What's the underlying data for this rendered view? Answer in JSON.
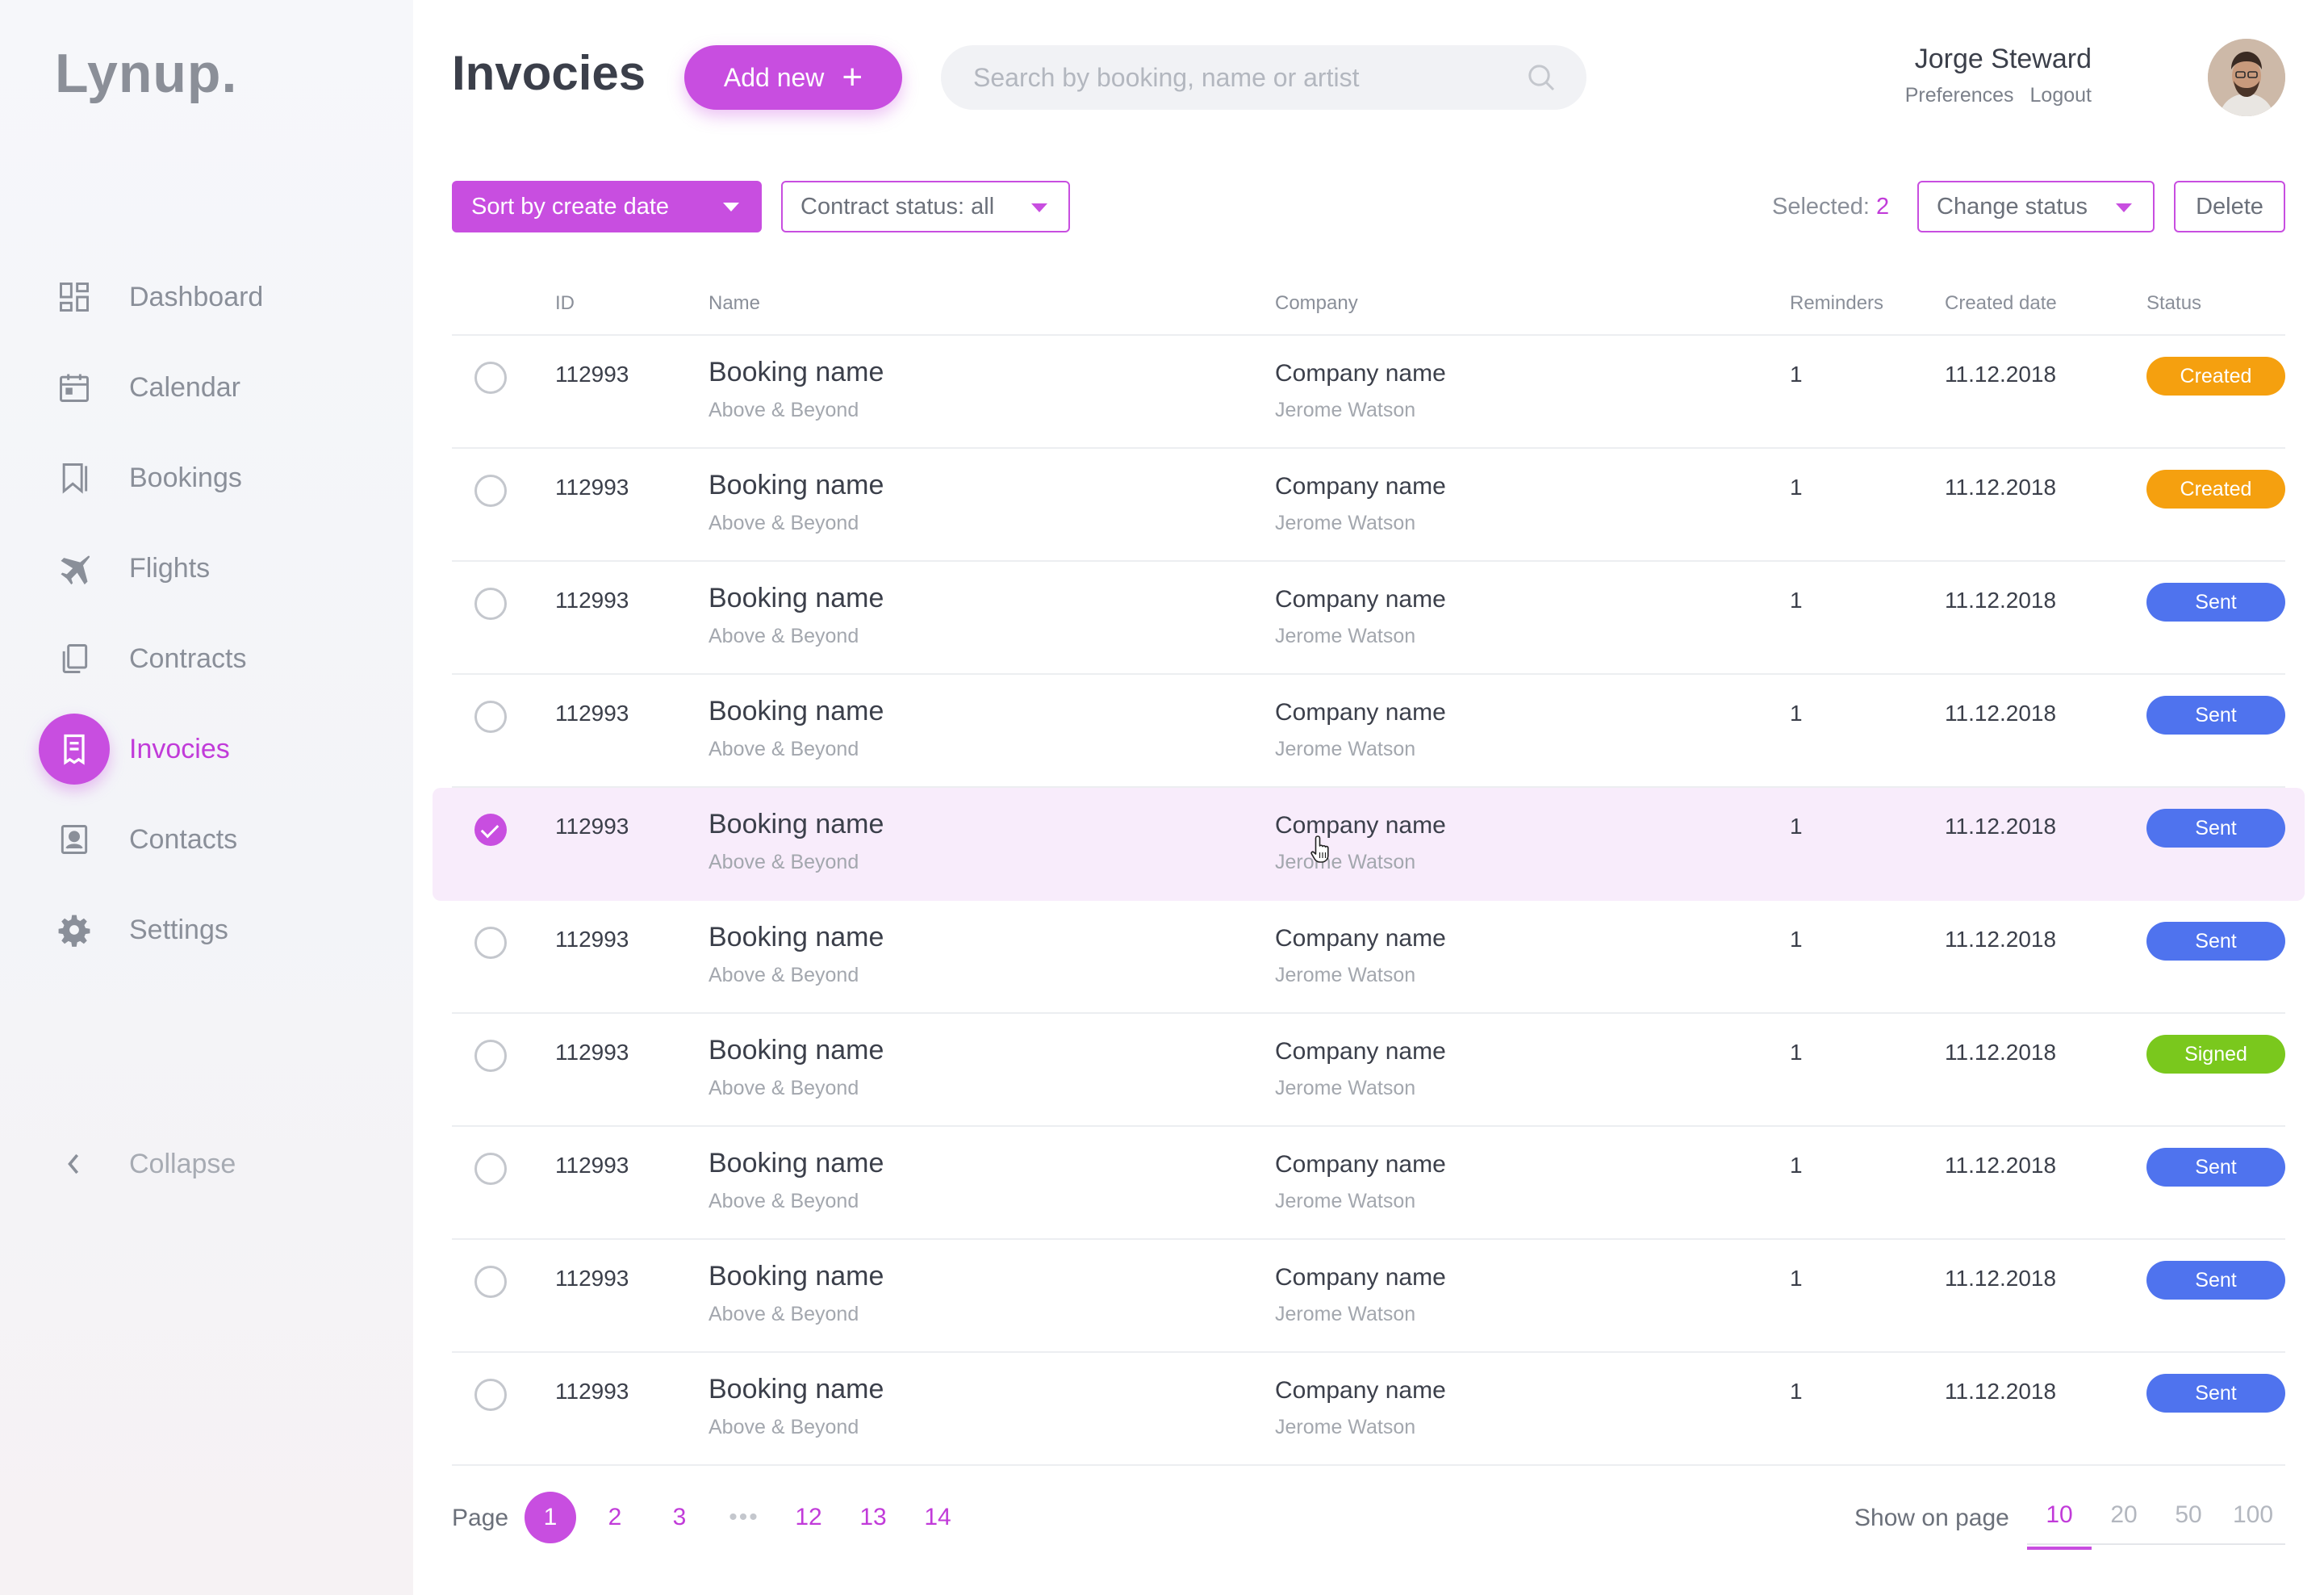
{
  "app": {
    "logo": "Lynup."
  },
  "sidebar": {
    "items": [
      {
        "label": "Dashboard",
        "icon": "grid-icon",
        "active": false
      },
      {
        "label": "Calendar",
        "icon": "calendar-icon",
        "active": false
      },
      {
        "label": "Bookings",
        "icon": "bookmark-icon",
        "active": false
      },
      {
        "label": "Flights",
        "icon": "airplane-icon",
        "active": false
      },
      {
        "label": "Contracts",
        "icon": "documents-icon",
        "active": false
      },
      {
        "label": "Invocies",
        "icon": "receipt-icon",
        "active": true
      },
      {
        "label": "Contacts",
        "icon": "contact-card-icon",
        "active": false
      },
      {
        "label": "Settings",
        "icon": "gear-icon",
        "active": false
      }
    ],
    "collapse_label": "Collapse"
  },
  "header": {
    "title": "Invocies",
    "add_new_label": "Add new",
    "search_placeholder": "Search by booking, name or artist",
    "user": {
      "name": "Jorge Steward",
      "preferences": "Preferences",
      "logout": "Logout"
    }
  },
  "toolbar": {
    "sort_label": "Sort by create date",
    "contract_filter_label": "Contract status: all",
    "selected_label": "Selected:",
    "selected_count": "2",
    "change_status_label": "Change status",
    "delete_label": "Delete"
  },
  "colors": {
    "accent": "#c84ee0",
    "created": "#f5a00f",
    "sent": "#4f73ee",
    "signed": "#7ac81d"
  },
  "table": {
    "columns": {
      "id": "ID",
      "name": "Name",
      "company": "Company",
      "reminders": "Reminders",
      "created": "Created date",
      "status": "Status"
    },
    "rows": [
      {
        "checked": false,
        "id": "112993",
        "name": "Booking name",
        "sub": "Above & Beyond",
        "company": "Company name",
        "contact": "Jerome Watson",
        "reminders": "1",
        "date": "11.12.2018",
        "status": "Created",
        "status_type": "created"
      },
      {
        "checked": false,
        "id": "112993",
        "name": "Booking name",
        "sub": "Above & Beyond",
        "company": "Company name",
        "contact": "Jerome Watson",
        "reminders": "1",
        "date": "11.12.2018",
        "status": "Created",
        "status_type": "created"
      },
      {
        "checked": false,
        "id": "112993",
        "name": "Booking name",
        "sub": "Above & Beyond",
        "company": "Company name",
        "contact": "Jerome Watson",
        "reminders": "1",
        "date": "11.12.2018",
        "status": "Sent",
        "status_type": "sent"
      },
      {
        "checked": false,
        "id": "112993",
        "name": "Booking name",
        "sub": "Above & Beyond",
        "company": "Company name",
        "contact": "Jerome Watson",
        "reminders": "1",
        "date": "11.12.2018",
        "status": "Sent",
        "status_type": "sent"
      },
      {
        "checked": true,
        "id": "112993",
        "name": "Booking name",
        "sub": "Above & Beyond",
        "company": "Company name",
        "contact": "Jerome Watson",
        "reminders": "1",
        "date": "11.12.2018",
        "status": "Sent",
        "status_type": "sent"
      },
      {
        "checked": false,
        "id": "112993",
        "name": "Booking name",
        "sub": "Above & Beyond",
        "company": "Company name",
        "contact": "Jerome Watson",
        "reminders": "1",
        "date": "11.12.2018",
        "status": "Sent",
        "status_type": "sent"
      },
      {
        "checked": false,
        "id": "112993",
        "name": "Booking name",
        "sub": "Above & Beyond",
        "company": "Company name",
        "contact": "Jerome Watson",
        "reminders": "1",
        "date": "11.12.2018",
        "status": "Signed",
        "status_type": "signed"
      },
      {
        "checked": false,
        "id": "112993",
        "name": "Booking name",
        "sub": "Above & Beyond",
        "company": "Company name",
        "contact": "Jerome Watson",
        "reminders": "1",
        "date": "11.12.2018",
        "status": "Sent",
        "status_type": "sent"
      },
      {
        "checked": false,
        "id": "112993",
        "name": "Booking name",
        "sub": "Above & Beyond",
        "company": "Company name",
        "contact": "Jerome Watson",
        "reminders": "1",
        "date": "11.12.2018",
        "status": "Sent",
        "status_type": "sent"
      },
      {
        "checked": false,
        "id": "112993",
        "name": "Booking name",
        "sub": "Above & Beyond",
        "company": "Company name",
        "contact": "Jerome Watson",
        "reminders": "1",
        "date": "11.12.2018",
        "status": "Sent",
        "status_type": "sent"
      }
    ]
  },
  "pagination": {
    "page_label": "Page",
    "pages": [
      "1",
      "2",
      "3",
      "•••",
      "12",
      "13",
      "14"
    ],
    "current": "1",
    "show_label": "Show on page",
    "per_page_options": [
      "10",
      "20",
      "50",
      "100"
    ],
    "per_page_current": "10"
  }
}
